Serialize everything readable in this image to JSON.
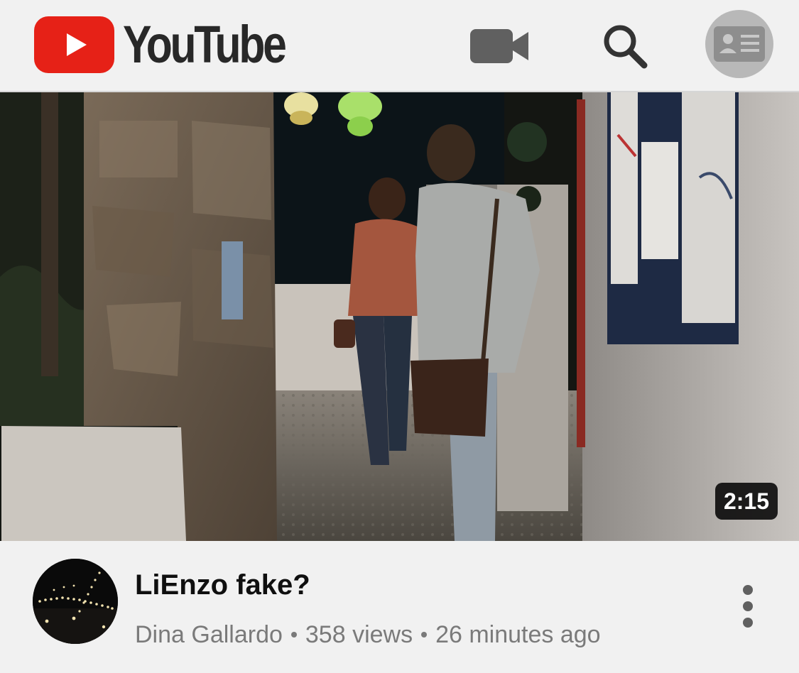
{
  "header": {
    "logo_text": "YouTube",
    "icons": {
      "upload": "video-camera-icon",
      "search": "search-icon",
      "account": "account-card-icon"
    },
    "brand_color": "#e62117"
  },
  "video": {
    "duration": "2:15",
    "title": "LiEnzo fake?",
    "channel": "Dina Gallardo",
    "views": "358 views",
    "age": "26 minutes ago"
  },
  "menu_icon": "more-vert-icon"
}
